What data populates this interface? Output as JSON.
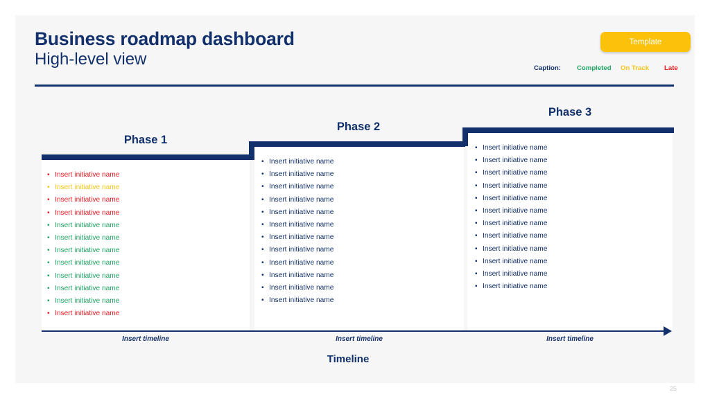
{
  "slide": {
    "page_number": "25",
    "background": "#f6f6f6"
  },
  "header": {
    "title": "Business roadmap dashboard",
    "subtitle": "High-level view",
    "template_button": "Template",
    "caption_label": "Caption:",
    "legend": [
      {
        "label": "Completed",
        "color": "#1fa463"
      },
      {
        "label": "On Track",
        "color": "#f5c518"
      },
      {
        "label": "Late",
        "color": "#ed1c24"
      }
    ],
    "accent_color": "#12306b",
    "template_color": "#fcc20b"
  },
  "roadmap": {
    "phases": [
      {
        "title": "Phase 1",
        "timeline_label": "Insert timeline",
        "items": [
          {
            "text": "Insert initiative name",
            "status": "Late",
            "color": "#ed1c24"
          },
          {
            "text": "Insert initiative name",
            "status": "On Track",
            "color": "#f5c518"
          },
          {
            "text": "Insert initiative name",
            "status": "Late",
            "color": "#ed1c24"
          },
          {
            "text": "Insert initiative name",
            "status": "Late",
            "color": "#ed1c24"
          },
          {
            "text": "Insert initiative name",
            "status": "Completed",
            "color": "#1fa463"
          },
          {
            "text": "Insert initiative name",
            "status": "Completed",
            "color": "#1fa463"
          },
          {
            "text": "Insert initiative name",
            "status": "Completed",
            "color": "#1fa463"
          },
          {
            "text": "Insert initiative name",
            "status": "Completed",
            "color": "#1fa463"
          },
          {
            "text": "Insert initiative name",
            "status": "Completed",
            "color": "#1fa463"
          },
          {
            "text": "Insert initiative name",
            "status": "Completed",
            "color": "#1fa463"
          },
          {
            "text": "Insert initiative name",
            "status": "Completed",
            "color": "#1fa463"
          },
          {
            "text": "Insert initiative name",
            "status": "Late",
            "color": "#ed1c24"
          }
        ]
      },
      {
        "title": "Phase 2",
        "timeline_label": "Insert timeline",
        "items": [
          {
            "text": "Insert initiative name",
            "status": "Planned",
            "color": "#12306b"
          },
          {
            "text": "Insert initiative name",
            "status": "Planned",
            "color": "#12306b"
          },
          {
            "text": "Insert initiative name",
            "status": "Planned",
            "color": "#12306b"
          },
          {
            "text": "Insert initiative name",
            "status": "Planned",
            "color": "#12306b"
          },
          {
            "text": "Insert initiative name",
            "status": "Planned",
            "color": "#12306b"
          },
          {
            "text": "Insert initiative name",
            "status": "Planned",
            "color": "#12306b"
          },
          {
            "text": "Insert initiative name",
            "status": "Planned",
            "color": "#12306b"
          },
          {
            "text": "Insert initiative name",
            "status": "Planned",
            "color": "#12306b"
          },
          {
            "text": "Insert initiative name",
            "status": "Planned",
            "color": "#12306b"
          },
          {
            "text": "Insert initiative name",
            "status": "Planned",
            "color": "#12306b"
          },
          {
            "text": "Insert initiative name",
            "status": "Planned",
            "color": "#12306b"
          },
          {
            "text": "Insert initiative name",
            "status": "Planned",
            "color": "#12306b"
          }
        ]
      },
      {
        "title": "Phase 3",
        "timeline_label": "Insert timeline",
        "items": [
          {
            "text": "Insert initiative name",
            "status": "Planned",
            "color": "#12306b"
          },
          {
            "text": "Insert initiative name",
            "status": "Planned",
            "color": "#12306b"
          },
          {
            "text": "Insert initiative name",
            "status": "Planned",
            "color": "#12306b"
          },
          {
            "text": "Insert initiative name",
            "status": "Planned",
            "color": "#12306b"
          },
          {
            "text": "Insert initiative name",
            "status": "Planned",
            "color": "#12306b"
          },
          {
            "text": "Insert initiative name",
            "status": "Planned",
            "color": "#12306b"
          },
          {
            "text": "Insert initiative name",
            "status": "Planned",
            "color": "#12306b"
          },
          {
            "text": "Insert initiative name",
            "status": "Planned",
            "color": "#12306b"
          },
          {
            "text": "Insert initiative name",
            "status": "Planned",
            "color": "#12306b"
          },
          {
            "text": "Insert initiative name",
            "status": "Planned",
            "color": "#12306b"
          },
          {
            "text": "Insert initiative name",
            "status": "Planned",
            "color": "#12306b"
          },
          {
            "text": "Insert initiative name",
            "status": "Planned",
            "color": "#12306b"
          }
        ]
      }
    ],
    "timeline_caption": "Timeline"
  }
}
